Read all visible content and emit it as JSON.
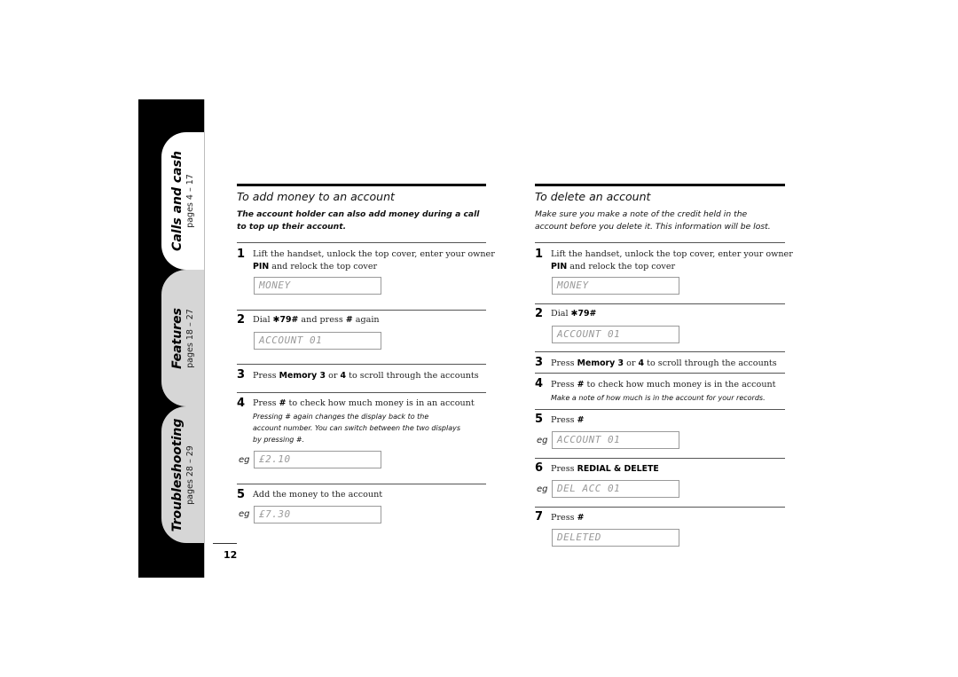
{
  "sidebar": {
    "tabs": [
      {
        "title": "Calls and cash",
        "pages": "pages 4 – 17",
        "active": true
      },
      {
        "title": "Features",
        "pages": "pages 18 – 27",
        "active": false
      },
      {
        "title": "Troubleshooting",
        "pages": "pages 28 – 29",
        "active": false
      }
    ]
  },
  "page_number": "12",
  "add_money": {
    "title": "To add money to an account",
    "intro": "The account holder can also add money during a call to top up their account.",
    "steps": [
      {
        "num": "1",
        "text_pre": "Lift the handset, unlock the top cover, enter your owner",
        "bold": "PIN",
        "text_post": " and relock the top cover",
        "display": "MONEY"
      },
      {
        "num": "2",
        "text_pre": "Dial ",
        "bold": "✱79#",
        "text_post": " and press ",
        "bold2": "#",
        "text_post2": " again",
        "display": "ACCOUNT 01"
      },
      {
        "num": "3",
        "text_pre": "Press ",
        "bold": "Memory 3",
        "text_mid": " or ",
        "bold2": "4",
        "text_post": " to scroll through the accounts"
      },
      {
        "num": "4",
        "text_pre": "Press ",
        "bold": "#",
        "text_post": " to check how much money is in an account",
        "note_line1": "Pressing # again changes the display back to the",
        "note_line2": "account number. You can switch between the two displays",
        "note_line3": "by pressing #.",
        "eg": "eg",
        "display": "£2.10"
      },
      {
        "num": "5",
        "text": "Add the money to the account",
        "eg": "eg",
        "display": "£7.30"
      }
    ]
  },
  "delete_account": {
    "title": "To delete an account",
    "intro_line1": "Make sure you make a note of the credit held in the",
    "intro_line2": "account before you delete it. This information will be lost.",
    "steps": [
      {
        "num": "1",
        "text_pre": "Lift the handset, unlock the top cover, enter your owner",
        "bold": "PIN",
        "text_post": " and relock the top cover",
        "display": "MONEY"
      },
      {
        "num": "2",
        "text_pre": "Dial ",
        "bold": "✱79#",
        "display": "ACCOUNT 01"
      },
      {
        "num": "3",
        "text_pre": "Press ",
        "bold": "Memory 3",
        "text_mid": " or ",
        "bold2": "4",
        "text_post": " to scroll through the accounts"
      },
      {
        "num": "4",
        "text_pre": "Press ",
        "bold": "#",
        "text_post": " to check how much money is in the account",
        "note": "Make a note of how much is in the account for your records."
      },
      {
        "num": "5",
        "text_pre": "Press ",
        "bold": "#",
        "eg": "eg",
        "display": "ACCOUNT 01"
      },
      {
        "num": "6",
        "text_pre": "Press ",
        "bold": "REDIAL & DELETE",
        "eg": "eg",
        "display": "DEL ACC 01"
      },
      {
        "num": "7",
        "text_pre": "Press ",
        "bold": "#",
        "display": "DELETED"
      }
    ]
  }
}
